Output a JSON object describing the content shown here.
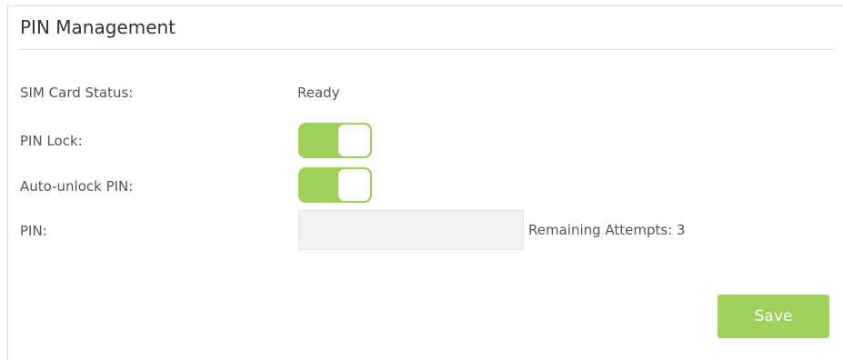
{
  "header": {
    "title": "PIN Management"
  },
  "rows": {
    "sim_status": {
      "label": "SIM Card Status:",
      "value": "Ready"
    },
    "pin_lock": {
      "label": "PIN Lock:",
      "enabled": true
    },
    "auto_unlock": {
      "label": "Auto-unlock PIN:",
      "enabled": true
    },
    "pin": {
      "label": "PIN:",
      "value": "",
      "remaining_attempts_text": "Remaining Attempts: 3"
    }
  },
  "actions": {
    "save_label": "Save"
  },
  "colors": {
    "accent": "#9fd05a",
    "input_bg": "#f2f2f2",
    "text": "#555555"
  }
}
